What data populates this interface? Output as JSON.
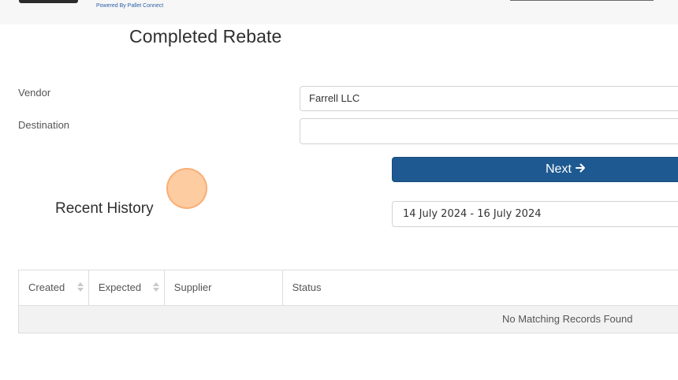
{
  "header": {
    "powered_by": "Powered By Pallet Connect"
  },
  "page": {
    "title": "Completed Rebate"
  },
  "form": {
    "vendor_label": "Vendor",
    "vendor_value": "Farrell LLC",
    "destination_label": "Destination",
    "destination_value": "",
    "next_label": "Next",
    "next_icon": "arrow-right-icon"
  },
  "history": {
    "title": "Recent History",
    "date_range": "14 July 2024 - 16 July 2024",
    "table": {
      "columns": [
        "Created",
        "Expected",
        "Supplier",
        "Status"
      ],
      "empty_message": "No Matching Records Found"
    }
  }
}
